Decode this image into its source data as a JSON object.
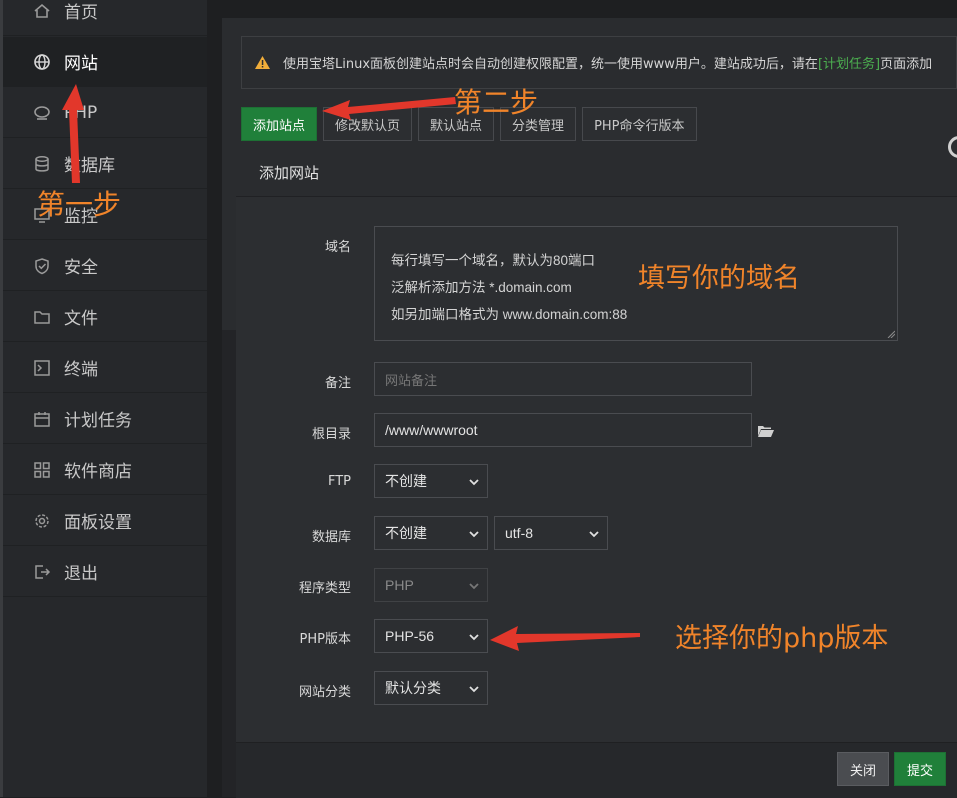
{
  "sidebar": {
    "items": [
      {
        "label": "首页",
        "icon": "home-icon"
      },
      {
        "label": "网站",
        "icon": "globe-icon",
        "active": true
      },
      {
        "label": "PHP",
        "icon": "php-icon"
      },
      {
        "label": "数据库",
        "icon": "database-icon"
      },
      {
        "label": "监控",
        "icon": "monitor-icon"
      },
      {
        "label": "安全",
        "icon": "shield-icon"
      },
      {
        "label": "文件",
        "icon": "folder-icon"
      },
      {
        "label": "终端",
        "icon": "terminal-icon"
      },
      {
        "label": "计划任务",
        "icon": "calendar-icon"
      },
      {
        "label": "软件商店",
        "icon": "apps-icon"
      },
      {
        "label": "面板设置",
        "icon": "gear-icon"
      },
      {
        "label": "退出",
        "icon": "logout-icon"
      }
    ]
  },
  "alert": {
    "text_before": "使用宝塔Linux面板创建站点时会自动创建权限配置，统一使用www用户。建站成功后，请在",
    "link": "[计划任务]",
    "text_after": "页面添加"
  },
  "tabs": [
    "添加站点",
    "修改默认页",
    "默认站点",
    "分类管理",
    "PHP命令行版本"
  ],
  "modal": {
    "title": "添加网站",
    "fields": {
      "domain_label": "域名",
      "domain_placeholder_lines": [
        "每行填写一个域名，默认为80端口",
        "泛解析添加方法 *.domain.com",
        "如另加端口格式为 www.domain.com:88"
      ],
      "remark_label": "备注",
      "remark_placeholder": "网站备注",
      "root_label": "根目录",
      "root_value": "/www/wwwroot",
      "ftp_label": "FTP",
      "ftp_value": "不创建",
      "db_label": "数据库",
      "db_value": "不创建",
      "charset_value": "utf-8",
      "program_label": "程序类型",
      "program_value": "PHP",
      "php_label": "PHP版本",
      "php_value": "PHP-56",
      "category_label": "网站分类",
      "category_value": "默认分类"
    },
    "buttons": {
      "close": "关闭",
      "submit": "提交"
    }
  },
  "annotations": {
    "step1": "第一步",
    "step2": "第二步",
    "domain_hint": "填写你的域名",
    "php_hint": "选择你的php版本",
    "color": "#f0842a"
  }
}
